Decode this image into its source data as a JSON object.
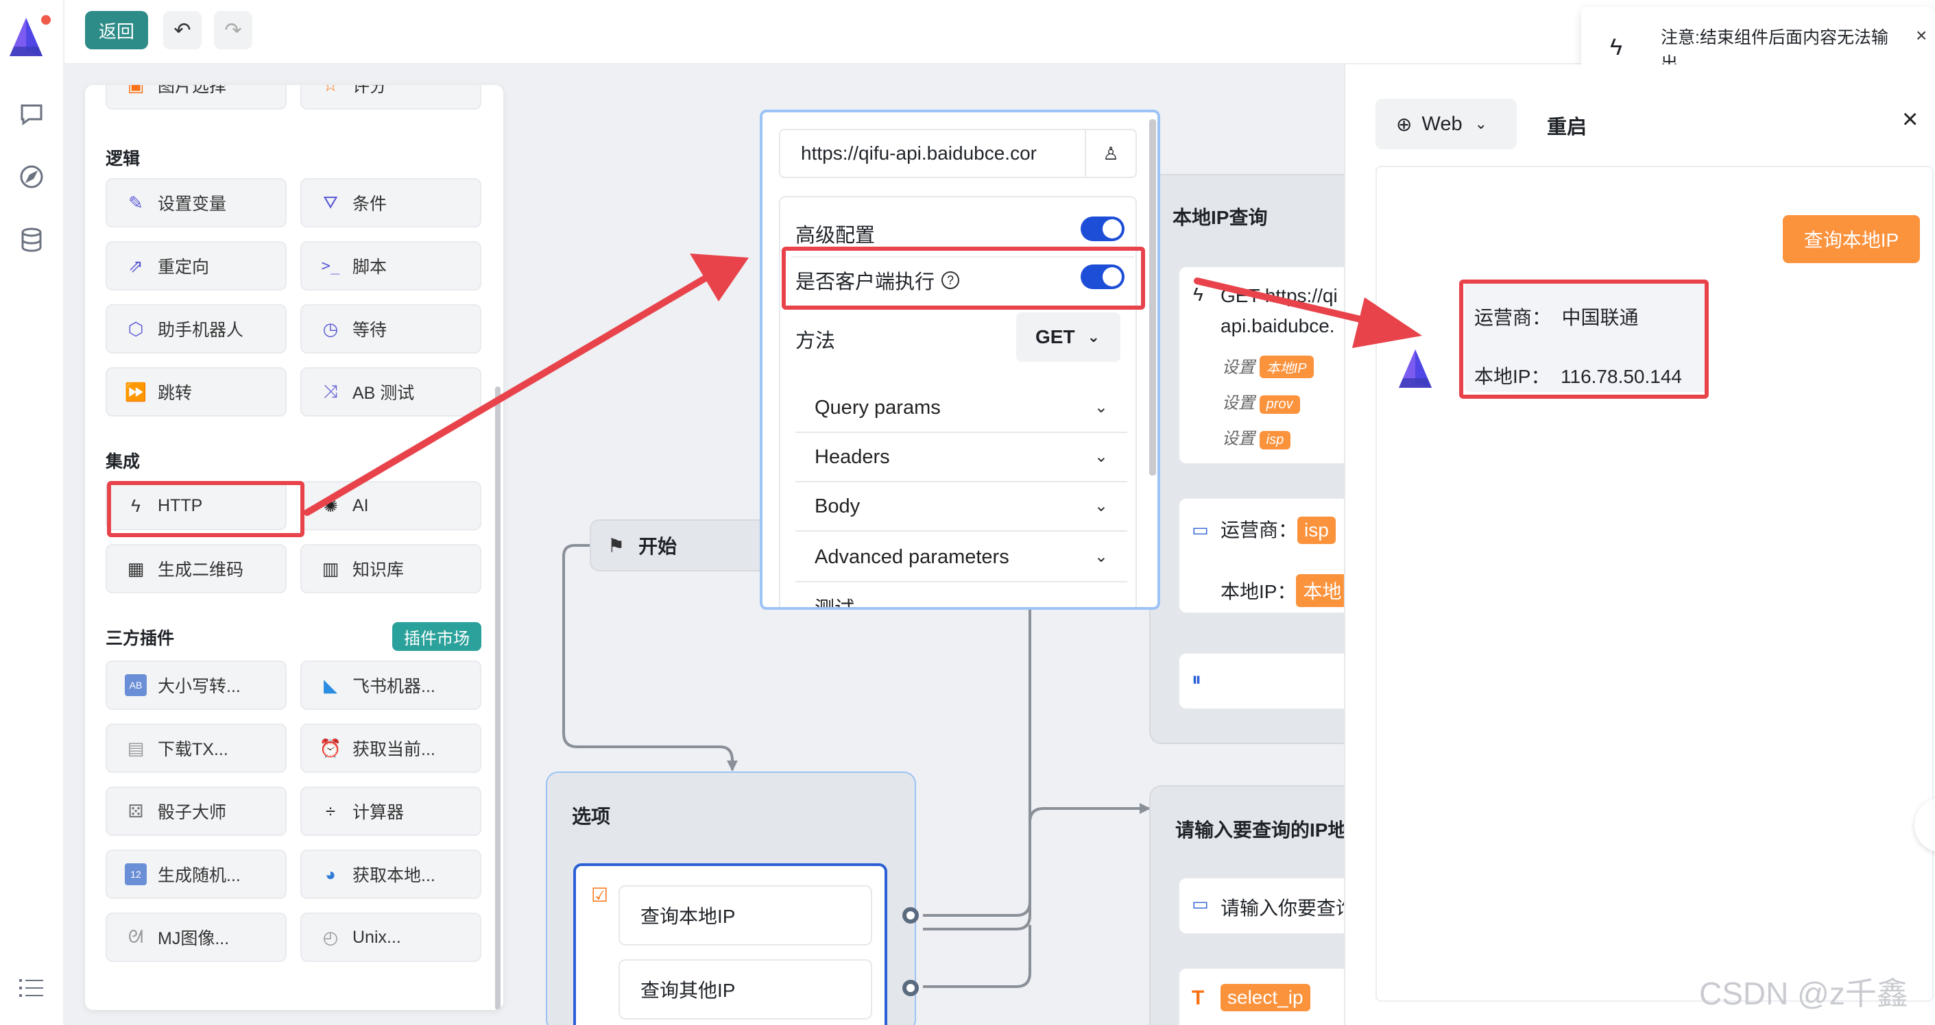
{
  "topbar": {
    "back_label": "返回",
    "undo_icon": "undo-icon",
    "redo_icon": "redo-icon"
  },
  "toast": {
    "text": "注意:结束组件后面内容无法输出。",
    "icon": "flash-icon",
    "close": "×"
  },
  "palette": {
    "top_items": [
      {
        "label": "图片选择",
        "icon": "image-icon"
      },
      {
        "label": "评分",
        "icon": "star-icon"
      }
    ],
    "sections": {
      "logic": "逻辑",
      "integration": "集成",
      "plugins": "三方插件",
      "plugin_market": "插件市场"
    },
    "logic_items": [
      {
        "label": "设置变量",
        "icon": "pencil-icon"
      },
      {
        "label": "条件",
        "icon": "filter-icon"
      },
      {
        "label": "重定向",
        "icon": "external-link-icon"
      },
      {
        "label": "脚本",
        "icon": "terminal-icon"
      },
      {
        "label": "助手机器人",
        "icon": "cube-icon"
      },
      {
        "label": "等待",
        "icon": "clock-icon"
      },
      {
        "label": "跳转",
        "icon": "fast-forward-icon"
      },
      {
        "label": "AB 测试",
        "icon": "shuffle-icon"
      }
    ],
    "integration_items": [
      {
        "label": "HTTP",
        "icon": "flash-icon"
      },
      {
        "label": "AI",
        "icon": "openai-icon"
      },
      {
        "label": "生成二维码",
        "icon": "qrcode-icon"
      },
      {
        "label": "知识库",
        "icon": "book-icon"
      }
    ],
    "plugin_items": [
      {
        "label": "大小写转...",
        "icon": "abc-icon"
      },
      {
        "label": "飞书机器...",
        "icon": "feishu-icon"
      },
      {
        "label": "下载TX...",
        "icon": "file-icon"
      },
      {
        "label": "获取当前...",
        "icon": "alarm-clock-icon"
      },
      {
        "label": "骰子大师",
        "icon": "dice-icon"
      },
      {
        "label": "计算器",
        "icon": "divide-icon"
      },
      {
        "label": "生成随机...",
        "icon": "numbers-icon"
      },
      {
        "label": "获取本地...",
        "icon": "globe-icon"
      },
      {
        "label": "MJ图像...",
        "icon": "rabbit-icon"
      },
      {
        "label": "Unix...",
        "icon": "stopwatch-icon"
      }
    ]
  },
  "http_popup": {
    "url": "https://qifu-api.baidubce.cor",
    "advanced_label": "高级配置",
    "advanced_on": true,
    "client_exec_label": "是否客户端执行",
    "client_exec_on": true,
    "method_label": "方法",
    "method_value": "GET",
    "sections": [
      "Query params",
      "Headers",
      "Body",
      "Advanced parameters",
      "测试"
    ]
  },
  "flow": {
    "start_label": "开始",
    "options_title": "选项",
    "options": [
      "查询本地IP",
      "查询其他IP"
    ],
    "local_ip_node": {
      "title": "本地IP查询",
      "http_line1": "GET https://qi",
      "http_line2": "api.baidubce.",
      "set_label": "设置",
      "vars": [
        "本地IP",
        "prov",
        "isp"
      ],
      "msg_label1": "运营商：",
      "msg_var1": "isp",
      "msg_label2": "本地IP：",
      "msg_var2": "本地"
    },
    "query_node": {
      "title": "请输入要查询的IP地",
      "prompt": "请输入你要查询",
      "var": "select_ip"
    }
  },
  "preview": {
    "mode": "Web",
    "restart": "重启",
    "user_button": "查询本地IP",
    "reply_line1": "运营商：  中国联通",
    "reply_line2": "本地IP：  116.78.50.144"
  },
  "watermark": "CSDN @z千鑫",
  "colors": {
    "accent": "#1d4ed8",
    "back_button": "#2d8c88",
    "highlight": "#e8434b",
    "orange": "#fb923c",
    "market": "#2aa19a"
  }
}
